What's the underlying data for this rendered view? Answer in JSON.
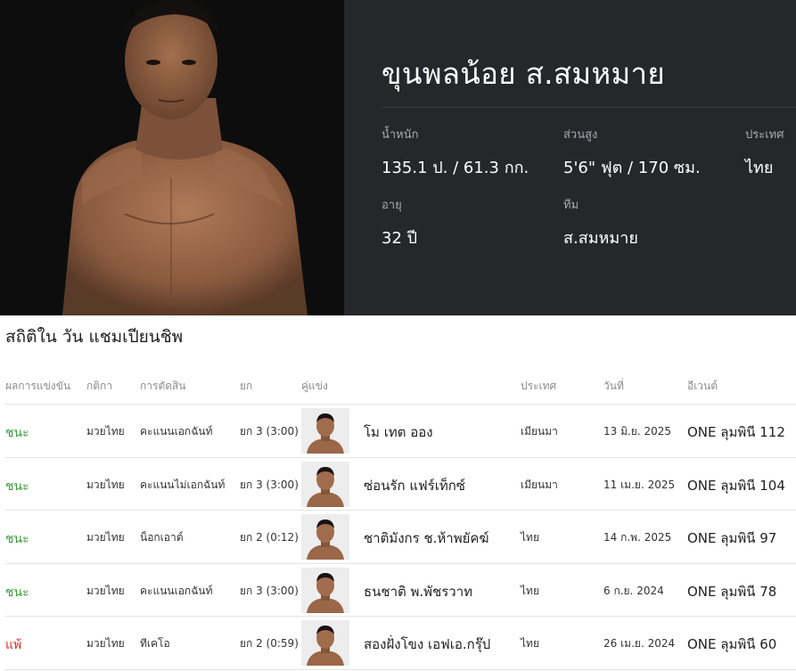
{
  "fighter": {
    "name": "ขุนพลน้อย ส.สมหมาย"
  },
  "stats": [
    {
      "label": "น้ำหนัก",
      "value": "135.1 ป. / 61.3 กก."
    },
    {
      "label": "ส่วนสูง",
      "value": "5'6\" ฟุต / 170 ซม."
    },
    {
      "label": "ประเทศ",
      "value": "ไทย"
    },
    {
      "label": "อายุ",
      "value": "32 ปี"
    },
    {
      "label": "ทีม",
      "value": "ส.สมหมาย"
    }
  ],
  "section": {
    "title": "สถิติใน วัน แชมเปียนชิพ"
  },
  "table": {
    "headers": {
      "result": "ผลการแข่งขัน",
      "rules": "กติกา",
      "method": "การตัดสิน",
      "round": "ยก",
      "opponent": "คู่แข่ง",
      "country": "ประเทศ",
      "date": "วันที่",
      "event": "อีเวนต์"
    },
    "rows": [
      {
        "result": "ชนะ",
        "outcome": "win",
        "rules": "มวยไทย",
        "method": "คะแนนเอกฉันท์",
        "round": "ยก 3 (3:00)",
        "opponent": "โม เทต ออง",
        "country": "เมียนมา",
        "date": "13 มิ.ย. 2025",
        "event": "ONE ลุมพินี 112"
      },
      {
        "result": "ชนะ",
        "outcome": "win",
        "rules": "มวยไทย",
        "method": "คะแนนไม่เอกฉันท์",
        "round": "ยก 3 (3:00)",
        "opponent": "ซ่อนรัก แฟร์เท็กซ์",
        "country": "เมียนมา",
        "date": "11 เม.ย. 2025",
        "event": "ONE ลุมพินี 104"
      },
      {
        "result": "ชนะ",
        "outcome": "win",
        "rules": "มวยไทย",
        "method": "น็อกเอาต์",
        "round": "ยก 2 (0:12)",
        "opponent": "ชาติมังกร ช.ห้าพยัคฆ์",
        "country": "ไทย",
        "date": "14 ก.พ. 2025",
        "event": "ONE ลุมพินี 97"
      },
      {
        "result": "ชนะ",
        "outcome": "win",
        "rules": "มวยไทย",
        "method": "คะแนนเอกฉันท์",
        "round": "ยก 3 (3:00)",
        "opponent": "ธนชาติ พ.พัชรวาท",
        "country": "ไทย",
        "date": "6 ก.ย. 2024",
        "event": "ONE ลุมพินี 78"
      },
      {
        "result": "แพ้",
        "outcome": "loss",
        "rules": "มวยไทย",
        "method": "ทีเคโอ",
        "round": "ยก 2 (0:59)",
        "opponent": "สองฝั่งโขง เอฟเอ.กรุ๊ป",
        "country": "ไทย",
        "date": "26 เม.ย. 2024",
        "event": "ONE ลุมพินี 60"
      }
    ]
  },
  "colors": {
    "hero_bg": "#26272b",
    "photo_bg": "#0d0d0d",
    "win": "#3a9b3a",
    "loss": "#d0312d"
  }
}
